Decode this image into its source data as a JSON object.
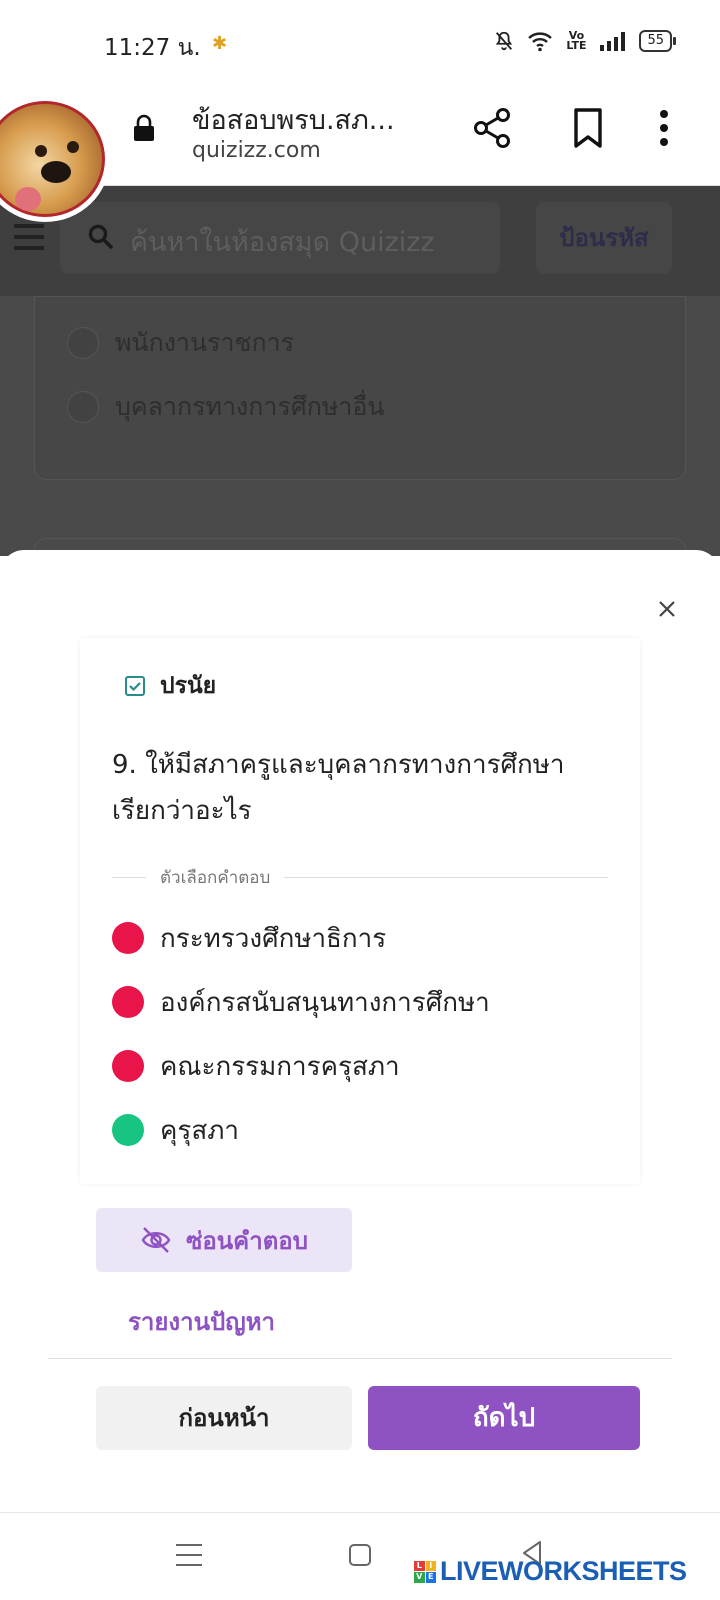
{
  "status_bar": {
    "time": "11:27 น.",
    "volte": "Vo LTE",
    "battery": "55"
  },
  "browser": {
    "title": "ข้อสอบพรบ.สภ...",
    "url": "quizizz.com"
  },
  "background_page": {
    "search_placeholder": "ค้นหาในห้องสมุด Quizizz",
    "enter_code_label": "ป้อนรหัส",
    "options": [
      "พนักงานราชการ",
      "บุคลากรทางการศึกษาอื่น"
    ]
  },
  "question": {
    "type_label": "ปรนัย",
    "text_line1": "9. ให้มีสภาครูและบุคลากรทางการศึกษา",
    "text_line2": "เรียกว่าอะไร",
    "answers_heading": "ตัวเลือกคำตอบ",
    "answers": [
      {
        "text": "กระทรวงศึกษาธิการ",
        "correct": false
      },
      {
        "text": "องค์กรสนับสนุนทางการศึกษา",
        "correct": false
      },
      {
        "text": "คณะกรรมการครุสภา",
        "correct": false
      },
      {
        "text": "คุรุสภา",
        "correct": true
      }
    ]
  },
  "actions": {
    "hide_answers": "ซ่อนคำตอบ",
    "report_problem": "รายงานปัญหา",
    "previous": "ก่อนหน้า",
    "next": "ถัดไป"
  },
  "watermark": {
    "text": "LIVEWORKSHEETS",
    "logo_letters": [
      "L",
      "I",
      "V",
      "E"
    ]
  },
  "colors": {
    "accent": "#8e52c2",
    "wrong": "#e8144a",
    "correct": "#17c481"
  }
}
